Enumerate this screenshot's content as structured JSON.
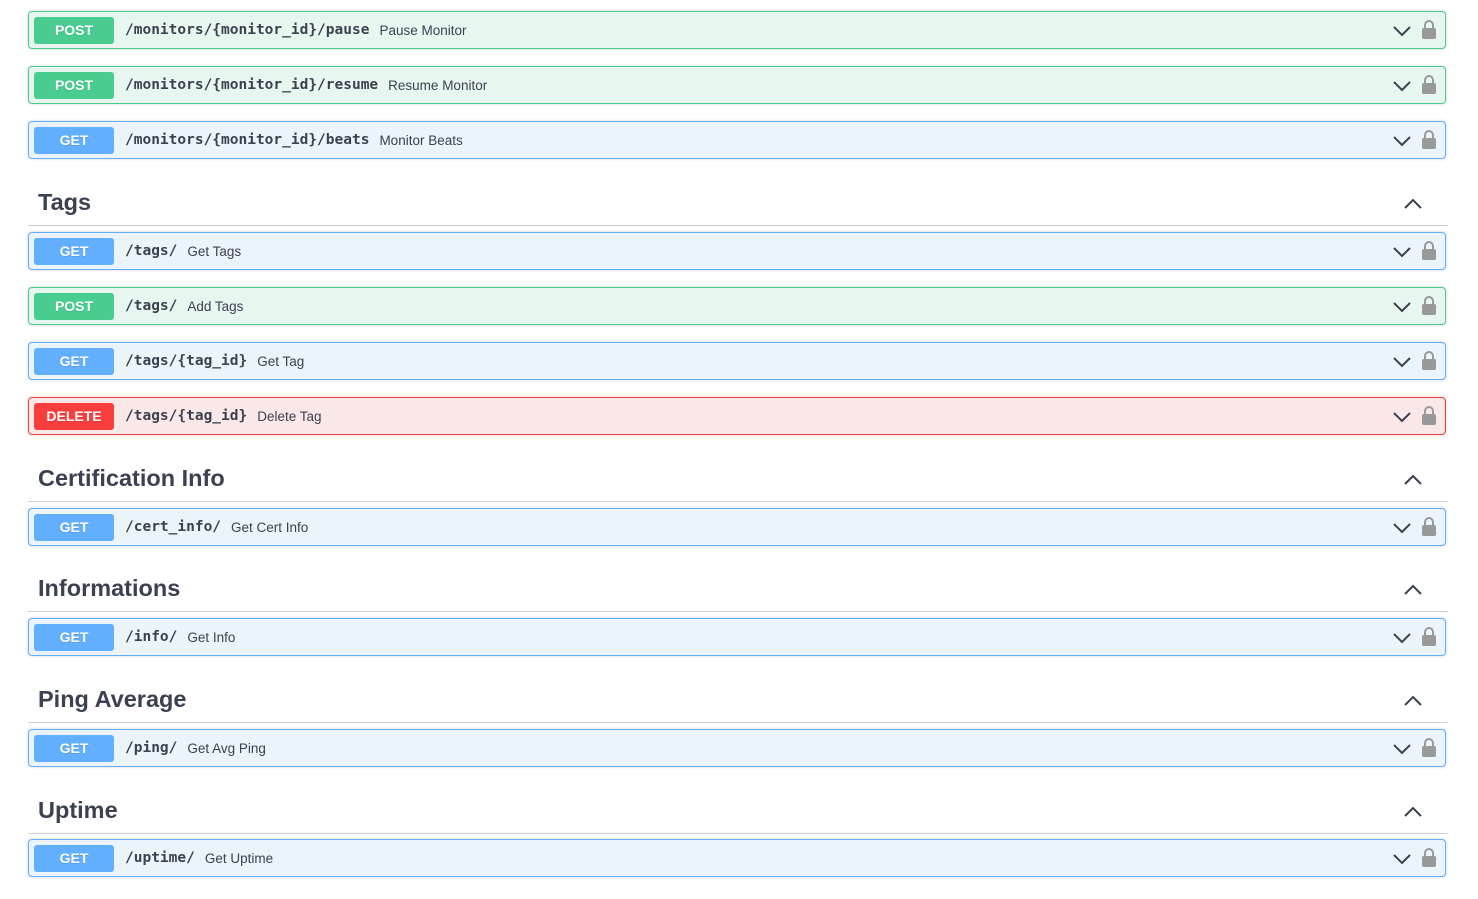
{
  "operations_top": [
    {
      "method": "POST",
      "path": "/monitors/{monitor_id}/pause",
      "summary": "Pause Monitor"
    },
    {
      "method": "POST",
      "path": "/monitors/{monitor_id}/resume",
      "summary": "Resume Monitor"
    },
    {
      "method": "GET",
      "path": "/monitors/{monitor_id}/beats",
      "summary": "Monitor Beats"
    }
  ],
  "tags": [
    {
      "title": "Tags",
      "operations": [
        {
          "method": "GET",
          "path": "/tags/",
          "summary": "Get Tags"
        },
        {
          "method": "POST",
          "path": "/tags/",
          "summary": "Add Tags"
        },
        {
          "method": "GET",
          "path": "/tags/{tag_id}",
          "summary": "Get Tag"
        },
        {
          "method": "DELETE",
          "path": "/tags/{tag_id}",
          "summary": "Delete Tag"
        }
      ]
    },
    {
      "title": "Certification Info",
      "operations": [
        {
          "method": "GET",
          "path": "/cert_info/",
          "summary": "Get Cert Info"
        }
      ]
    },
    {
      "title": "Informations",
      "operations": [
        {
          "method": "GET",
          "path": "/info/",
          "summary": "Get Info"
        }
      ]
    },
    {
      "title": "Ping Average",
      "operations": [
        {
          "method": "GET",
          "path": "/ping/",
          "summary": "Get Avg Ping"
        }
      ]
    },
    {
      "title": "Uptime",
      "operations": [
        {
          "method": "GET",
          "path": "/uptime/",
          "summary": "Get Uptime"
        }
      ]
    }
  ],
  "icons": {
    "expand": "chevron-down-icon",
    "collapse": "chevron-up-icon",
    "auth": "lock-icon"
  },
  "colors": {
    "get": "#61affe",
    "post": "#49cc90",
    "delete": "#f93e3e"
  }
}
